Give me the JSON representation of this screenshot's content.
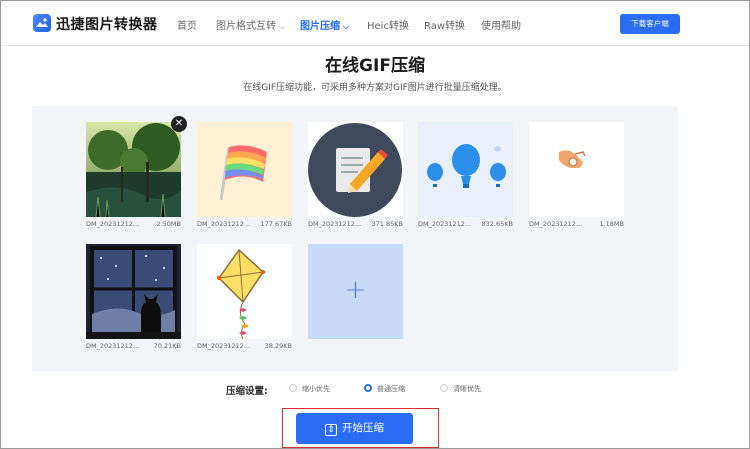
{
  "header": {
    "brand": "迅捷图片转换器",
    "nav": [
      {
        "label": "首页",
        "dropdown": false,
        "active": false
      },
      {
        "label": "图片格式互转",
        "dropdown": true,
        "active": false
      },
      {
        "label": "图片压缩",
        "dropdown": true,
        "active": true
      },
      {
        "label": "Heic转换",
        "dropdown": false,
        "active": false
      },
      {
        "label": "Raw转换",
        "dropdown": false,
        "active": false
      },
      {
        "label": "使用帮助",
        "dropdown": false,
        "active": false
      }
    ],
    "download_label": "下载客户端"
  },
  "page": {
    "title": "在线GIF压缩",
    "subtitle": "在线GIF压缩功能，可采用多种方案对GIF图片进行批量压缩处理。"
  },
  "files": [
    {
      "name": "DM_20231212...",
      "size": "2.50MB",
      "thumb": "forest-image"
    },
    {
      "name": "DM_20231212...",
      "size": "177.67KB",
      "thumb": "rainbow-flag-image"
    },
    {
      "name": "DM_20231212...",
      "size": "371.85KB",
      "thumb": "notepad-pencil-image"
    },
    {
      "name": "DM_20231212...",
      "size": "832.65KB",
      "thumb": "hot-air-balloons-image"
    },
    {
      "name": "DM_20231212...",
      "size": "1.18MB",
      "thumb": "hand-gesture-image"
    },
    {
      "name": "DM_20231212...",
      "size": "70.21KB",
      "thumb": "cat-window-image"
    },
    {
      "name": "DM_20231212...",
      "size": "38.29KB",
      "thumb": "kite-image"
    }
  ],
  "add_icon": "plus-icon",
  "remove_icon": "close-icon",
  "settings": {
    "label": "压缩设置:",
    "options": [
      {
        "label": "缩小优先",
        "checked": false
      },
      {
        "label": "普通压缩",
        "checked": true
      },
      {
        "label": "清晰优先",
        "checked": false
      }
    ]
  },
  "start_button": {
    "label": "开始压缩",
    "icon": "compress-icon"
  },
  "colors": {
    "accent": "#2a6df4",
    "panel_bg": "#f2f4f8",
    "highlight_border": "#d93030"
  }
}
